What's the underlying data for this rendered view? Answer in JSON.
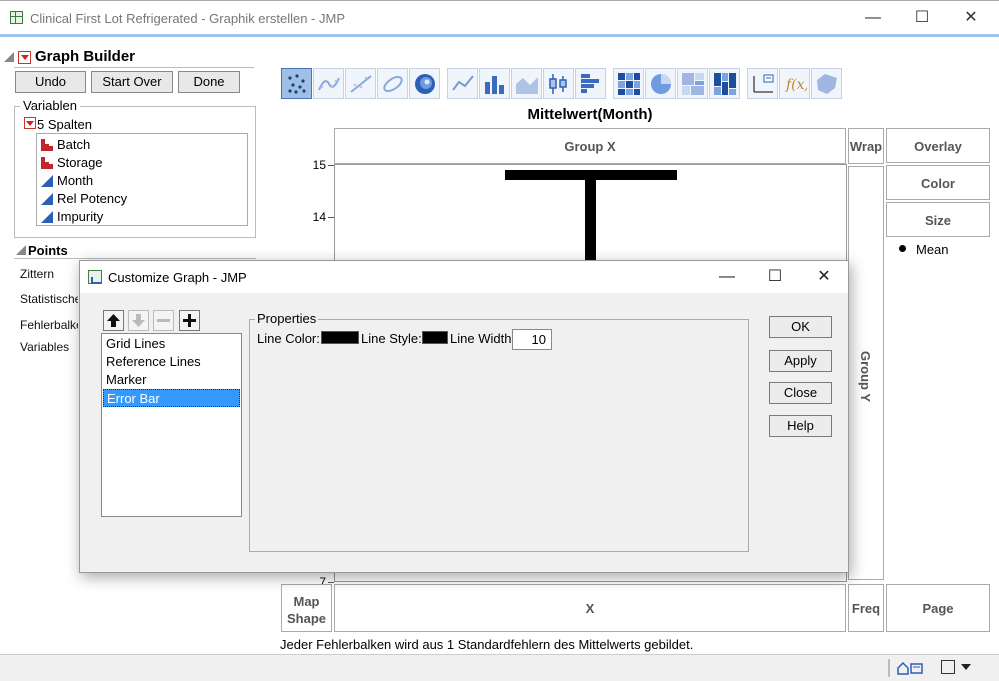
{
  "window": {
    "title": "Clinical First Lot Refrigerated - Graphik erstellen - JMP",
    "minimize": "—",
    "maximize": "☐",
    "close": "✕"
  },
  "graph_builder": {
    "title": "Graph Builder",
    "buttons": {
      "undo": "Undo",
      "start_over": "Start Over",
      "done": "Done"
    },
    "variables": {
      "legend": "Variablen",
      "column_count": "5 Spalten",
      "columns": [
        {
          "name": "Batch",
          "type": "nominal"
        },
        {
          "name": "Storage",
          "type": "nominal"
        },
        {
          "name": "Month",
          "type": "continuous"
        },
        {
          "name": "Rel Potency",
          "type": "continuous"
        },
        {
          "name": "Impurity",
          "type": "continuous"
        }
      ]
    },
    "points": {
      "label": "Points",
      "options": [
        "Zittern",
        "Statistische",
        "Fehlerbalken",
        "Variables"
      ]
    },
    "toolbar_icons": [
      "points-icon",
      "contour-smoother-icon",
      "line-of-fit-icon",
      "ellipse-icon",
      "contour-icon",
      "line-icon",
      "bar-icon",
      "area-icon",
      "box-plot-icon",
      "histogram-icon",
      "heatmap-icon",
      "pie-icon",
      "treemap-icon",
      "mosaic-icon",
      "caption-box-icon",
      "formula-icon",
      "map-shape-icon"
    ],
    "graph": {
      "title": "Mittelwert(Month)",
      "zones": {
        "group_x": "Group X",
        "wrap": "Wrap",
        "overlay": "Overlay",
        "color": "Color",
        "size": "Size",
        "group_y": "Group Y",
        "map_shape_line1": "Map",
        "map_shape_line2": "Shape",
        "x": "X",
        "freq": "Freq",
        "page": "Page"
      },
      "y_ticks": [
        "15",
        "14",
        "7"
      ],
      "legend_item": "Mean"
    },
    "footnote": "Jeder Fehlerbalken wird aus 1 Standardfehlern des Mittelwerts gebildet."
  },
  "dialog": {
    "title": "Customize Graph - JMP",
    "minimize": "—",
    "maximize": "☐",
    "close": "✕",
    "list_tools": {
      "up": "up-arrow-icon",
      "down": "down-arrow-icon",
      "remove": "minus-icon",
      "add": "plus-icon"
    },
    "elements": [
      "Grid Lines",
      "Reference Lines",
      "Marker",
      "Error Bar"
    ],
    "selected_element": "Error Bar",
    "properties": {
      "legend": "Properties",
      "line_color_label": "Line Color:",
      "line_color": "#000000",
      "line_style_label": "Line Style:",
      "line_width_label": "Line Width",
      "line_width": "10"
    },
    "buttons": {
      "ok": "OK",
      "apply": "Apply",
      "close": "Close",
      "help": "Help"
    }
  }
}
